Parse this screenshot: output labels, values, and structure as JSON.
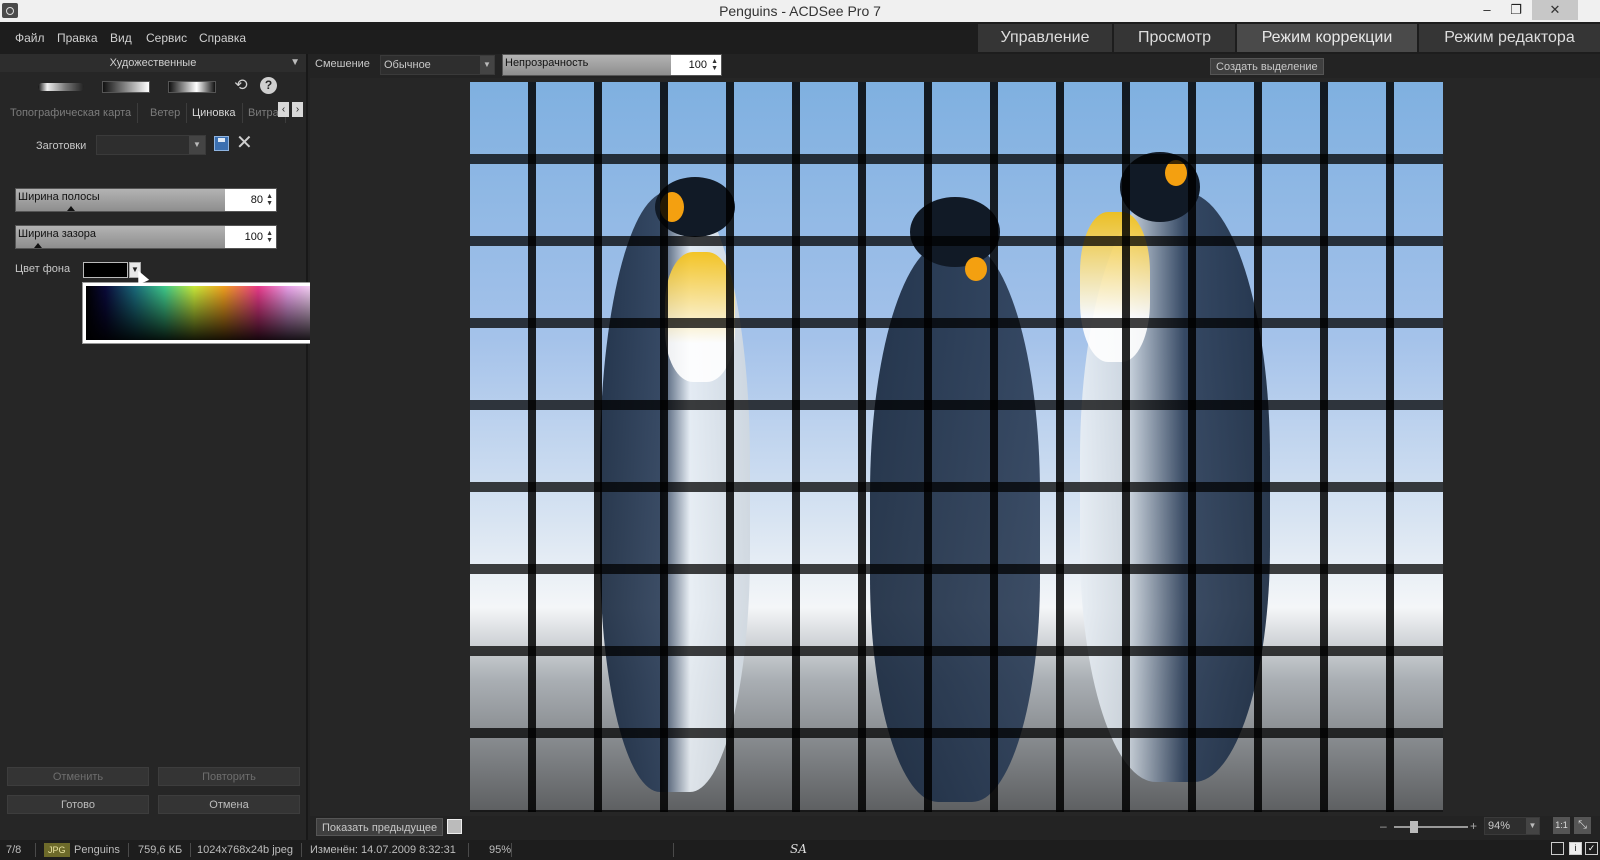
{
  "window": {
    "title": "Penguins - ACDSee Pro 7",
    "minimize_glyph": "–",
    "restore_glyph": "❐",
    "close_glyph": "✕"
  },
  "menu": {
    "items": [
      "Файл",
      "Правка",
      "Вид",
      "Сервис",
      "Справка"
    ]
  },
  "modes": {
    "tabs": [
      {
        "label": "Управление",
        "active": false
      },
      {
        "label": "Просмотр",
        "active": false
      },
      {
        "label": "Режим коррекции",
        "active": true
      },
      {
        "label": "Режим редактора",
        "active": false
      }
    ]
  },
  "panel": {
    "category": "Художественные",
    "effect_tabs": [
      {
        "label": "Топографическая карта",
        "active": false
      },
      {
        "label": "Ветер",
        "active": false
      },
      {
        "label": "Циновка",
        "active": true
      },
      {
        "label": "Витра",
        "active": false
      }
    ],
    "presets_label": "Заготовки",
    "presets_value": "",
    "strip_width": {
      "label": "Ширина полосы",
      "value": "80"
    },
    "gap_width": {
      "label": "Ширина зазора",
      "value": "100"
    },
    "bg_color_label": "Цвет фона",
    "bg_color": "#000000",
    "buttons": {
      "undo": "Отменить",
      "redo": "Повторить",
      "done": "Готово",
      "cancel": "Отмена"
    }
  },
  "toolbar": {
    "blend_label": "Смешение",
    "blend_value": "Обычное",
    "opacity_label": "Непрозрачность",
    "opacity_value": "100",
    "create_selection": "Создать выделение"
  },
  "bottom": {
    "show_previous": "Показать предыдущее",
    "zoom_minus": "–",
    "zoom_plus": "+",
    "zoom_value": "94%",
    "btn_1to1": "1:1",
    "btn_fit": "⤡"
  },
  "status": {
    "position": "7/8",
    "file_type": "JPG",
    "file_name": "Penguins",
    "file_size": "759,6 КБ",
    "dimensions": "1024x768x24b jpeg",
    "modified": "Изменён: 14.07.2009 8:32:31",
    "zoom": "95%",
    "logo": "SA"
  },
  "colors": {
    "accent": "#4a4a4a",
    "background": "#232323"
  }
}
